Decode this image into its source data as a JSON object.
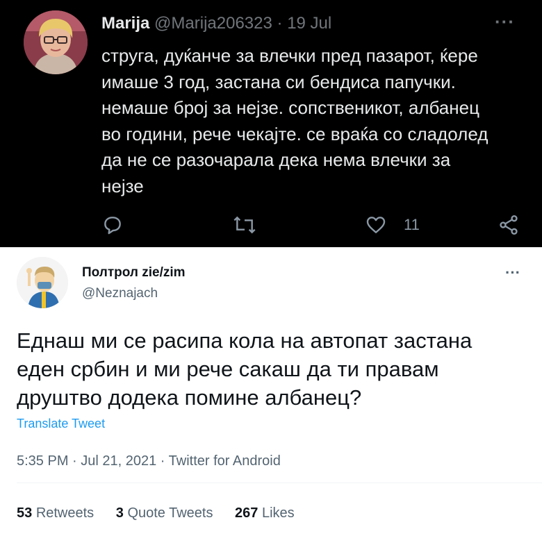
{
  "top_tweet": {
    "name": "Marija",
    "handle": "@Marija206323",
    "separator": "·",
    "date": "19 Jul",
    "more_label": "···",
    "text_lines": [
      "струга, дуќанче за влечки пред пазарот, ќере",
      "имаше 3 год, застана си бендиса папучки.",
      "немаше број за нејзе. сопственикот, албанец",
      "во години, рече чекајте. се враќа со сладолед",
      "да не се разочарала дека нема влечки за",
      "нејзе"
    ],
    "like_count": "11",
    "icons": [
      "reply-icon",
      "retweet-icon",
      "like-icon",
      "share-icon"
    ]
  },
  "bottom_tweet": {
    "name": "Полтрол zie/zim",
    "handle": "@Neznajach",
    "more_label": "···",
    "text_lines": [
      "Еднаш ми се расипа кола на автопат застана",
      "еден србин и ми рече сакаш да ти правам",
      "друштво додека помине албанец?"
    ],
    "translate_label": "Translate Tweet",
    "timestamp": "5:35 PM · Jul 21, 2021 · Twitter for Android",
    "stats": {
      "retweets_count": "53",
      "retweets_label": "Retweets",
      "quotes_count": "3",
      "quotes_label": "Quote Tweets",
      "likes_count": "267",
      "likes_label": "Likes"
    }
  },
  "colors": {
    "dark_bg": "#000000",
    "dark_text": "#e7e9ea",
    "dark_muted": "#71767b",
    "light_text": "#0f1419",
    "light_muted": "#536471",
    "accent": "#1d9bf0"
  }
}
